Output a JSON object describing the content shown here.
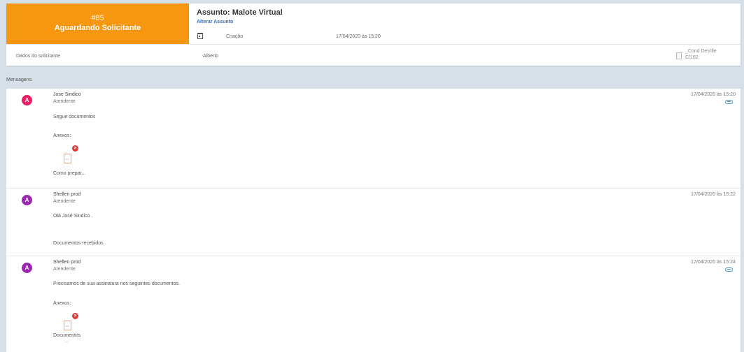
{
  "ticket": {
    "number": "#85",
    "status": "Aguardando Solicitante",
    "status_color": "#f7960f",
    "subject_title": "Assunto: Malote Virtual",
    "alter_subject_link": "Alterar Assunto",
    "criacao_label": "Criação",
    "criacao_value": "17/04/2020 às 15:20",
    "dados_label": "Dados do solicitante",
    "dados_value": "Alberto",
    "cond_line1": "_Cond DeVille",
    "cond_line2": "C/102"
  },
  "messages_section_label": "Mensagens",
  "messages": [
    {
      "avatar_letter": "A",
      "avatar_color": "#e91e63",
      "author": "Jose Sindico",
      "role": "Atendente",
      "date": "17/04/2020 às 15:20",
      "has_attachment_icon": true,
      "lines": [
        "Segue documentos"
      ],
      "attachments_label": "Anexos:",
      "attachment_name": "Como prepar..."
    },
    {
      "avatar_letter": "A",
      "avatar_color": "#9c27b0",
      "author": "Shellen prod",
      "role": "Atendente",
      "date": "17/04/2020 às 15:22",
      "has_attachment_icon": false,
      "lines": [
        "Olá José Sindico .",
        "Documentos  recebidos ."
      ]
    },
    {
      "avatar_letter": "A",
      "avatar_color": "#9c27b0",
      "author": "Shellen prod",
      "role": "Atendente",
      "date": "17/04/2020 às 15:24",
      "has_attachment_icon": true,
      "lines": [
        "Precisamos de sua assinatura nos seguintes documentos."
      ],
      "attachments_label": "Anexos:",
      "attachment_name": "Documentos",
      "attachment_name_more": "..."
    }
  ],
  "icons": {
    "pdf_icon_text": "PDF",
    "remove_icon_glyph": "×"
  }
}
